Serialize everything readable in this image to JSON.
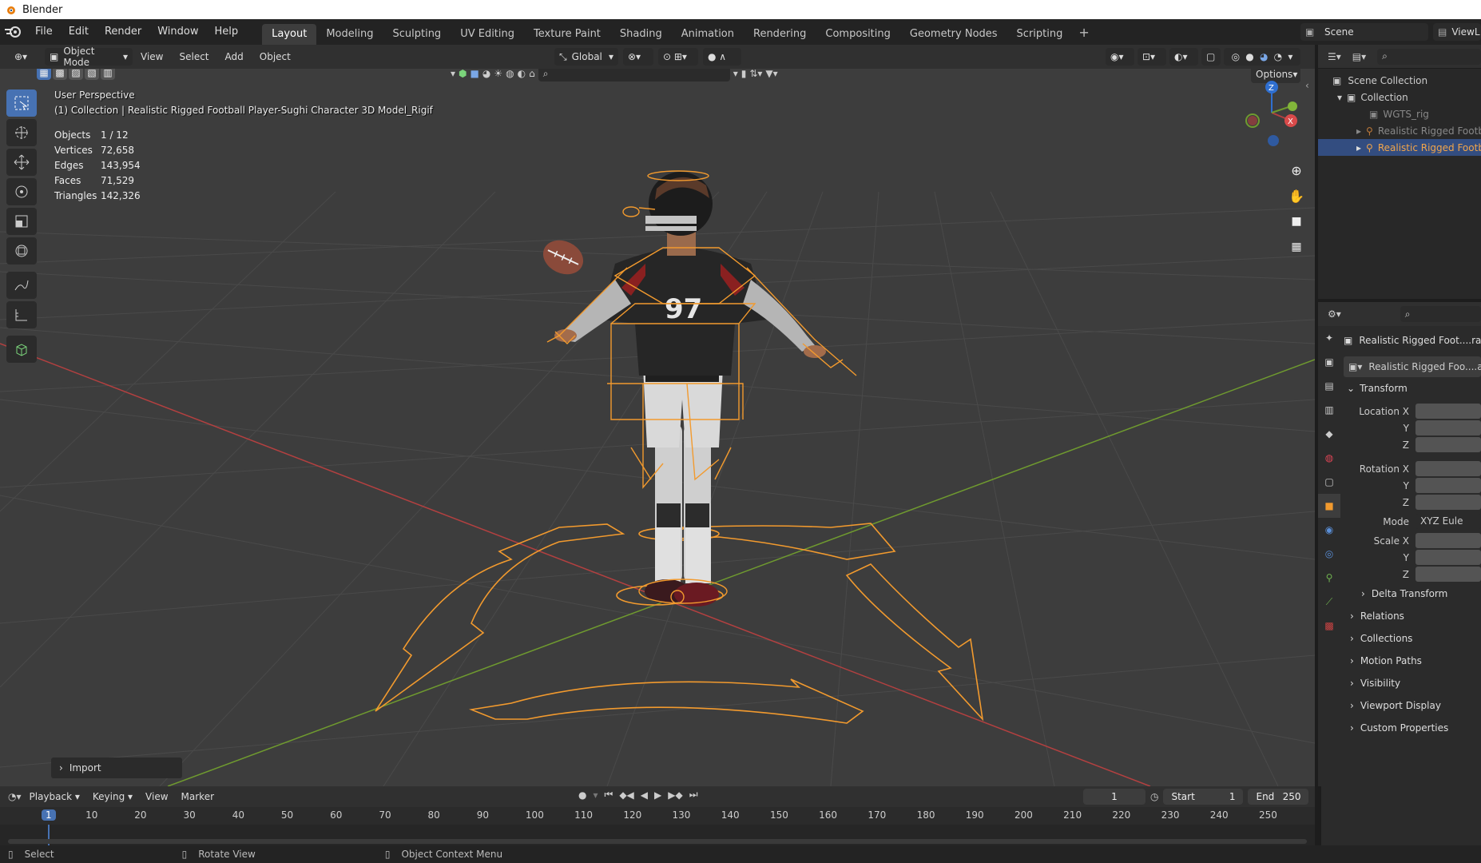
{
  "app": {
    "title": "Blender"
  },
  "menu": {
    "file": "File",
    "edit": "Edit",
    "render": "Render",
    "window": "Window",
    "help": "Help"
  },
  "workspaces": [
    "Layout",
    "Modeling",
    "Sculpting",
    "UV Editing",
    "Texture Paint",
    "Shading",
    "Animation",
    "Rendering",
    "Compositing",
    "Geometry Nodes",
    "Scripting"
  ],
  "scene": {
    "name": "Scene",
    "view_layer": "ViewL"
  },
  "viewport_header": {
    "mode": "Object Mode",
    "view": "View",
    "select": "Select",
    "add": "Add",
    "object": "Object",
    "orientation": "Global",
    "options": "Options"
  },
  "viewport": {
    "perspective": "User Perspective",
    "collection_info": "(1) Collection | Realistic Rigged Football Player-Sughi Character 3D Model_Rigif",
    "stats": [
      {
        "k": "Objects",
        "v": "1 / 12"
      },
      {
        "k": "Vertices",
        "v": "72,658"
      },
      {
        "k": "Edges",
        "v": "143,954"
      },
      {
        "k": "Faces",
        "v": "71,529"
      },
      {
        "k": "Triangles",
        "v": "142,326"
      }
    ],
    "jersey_number": "97",
    "gizmo": {
      "z": "Z",
      "x": "X",
      "y": "Y"
    },
    "last_op": "Import"
  },
  "outliner": {
    "items": [
      {
        "label": "Scene Collection"
      },
      {
        "label": "Collection"
      },
      {
        "label": "WGTS_rig"
      },
      {
        "label": "Realistic Rigged Footba"
      },
      {
        "label": "Realistic Rigged Footba"
      }
    ]
  },
  "properties": {
    "object_name": "Realistic Rigged Foot....ract",
    "data_name": "Realistic Rigged Foo....ac",
    "transform": "Transform",
    "location_x": "Location X",
    "y": "Y",
    "z": "Z",
    "rotation_x": "Rotation X",
    "mode_label": "Mode",
    "mode_value": "XYZ Eule",
    "scale_x": "Scale X",
    "panels": [
      "Delta Transform",
      "Relations",
      "Collections",
      "Motion Paths",
      "Visibility",
      "Viewport Display",
      "Custom Properties"
    ]
  },
  "timeline": {
    "playback": "Playback",
    "keying": "Keying",
    "view": "View",
    "marker": "Marker",
    "current_frame": "1",
    "start_label": "Start",
    "start": "1",
    "end_label": "End",
    "end": "250",
    "ticks": [
      "1",
      "10",
      "20",
      "30",
      "40",
      "50",
      "60",
      "70",
      "80",
      "90",
      "100",
      "110",
      "120",
      "130",
      "140",
      "150",
      "160",
      "170",
      "180",
      "190",
      "200",
      "210",
      "220",
      "230",
      "240",
      "250"
    ]
  },
  "status": {
    "select": "Select",
    "rotate": "Rotate View",
    "context": "Object Context Menu"
  },
  "colors": {
    "accent": "#4772b3",
    "rig": "#f29a2e",
    "x_axis": "#b34040",
    "y_axis": "#6f9a2f",
    "z_axis": "#2f6fd0"
  }
}
